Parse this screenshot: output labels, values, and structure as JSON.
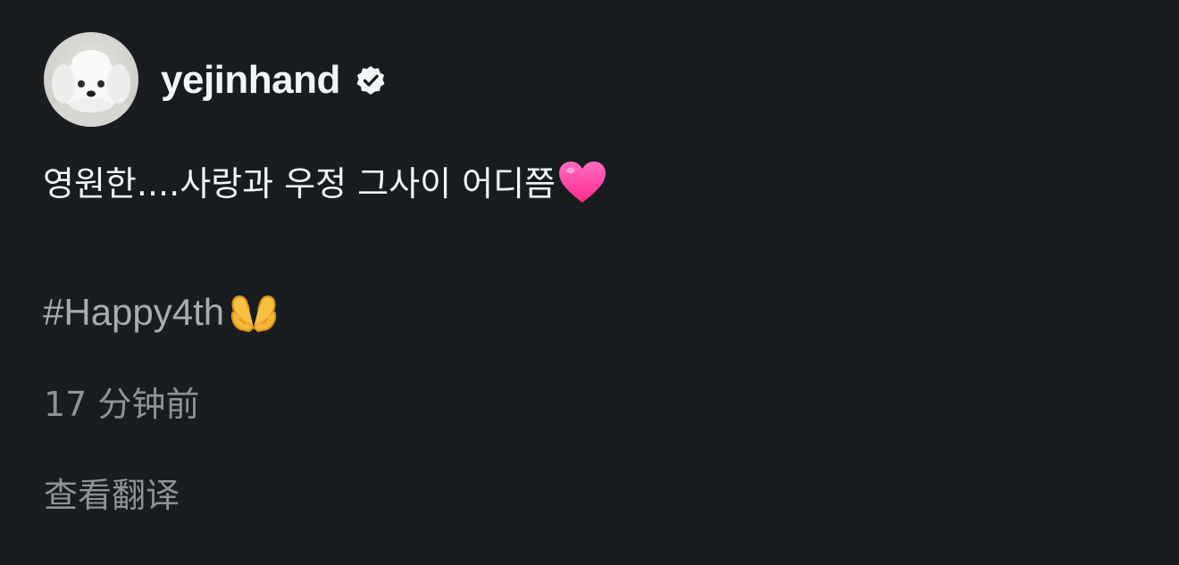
{
  "post": {
    "author": {
      "username": "yejinhand",
      "verified_icon": "verified-badge-icon",
      "avatar_icon": "white-puppy-avatar"
    },
    "body": "영원한....사랑과 우정 그사이 어디쯤",
    "body_emoji": "pink-heart-icon",
    "hashtag": "#Happy4th",
    "hashtag_emoji": "heart-hands-icon",
    "timestamp": "17 分钟前",
    "translate_label": "查看翻译"
  },
  "colors": {
    "background": "#181c1f",
    "primary_text": "#f3f5f7",
    "hashtag_text": "#a8abb0",
    "secondary_text": "#8f9296",
    "heart": "#ff3fa4"
  }
}
